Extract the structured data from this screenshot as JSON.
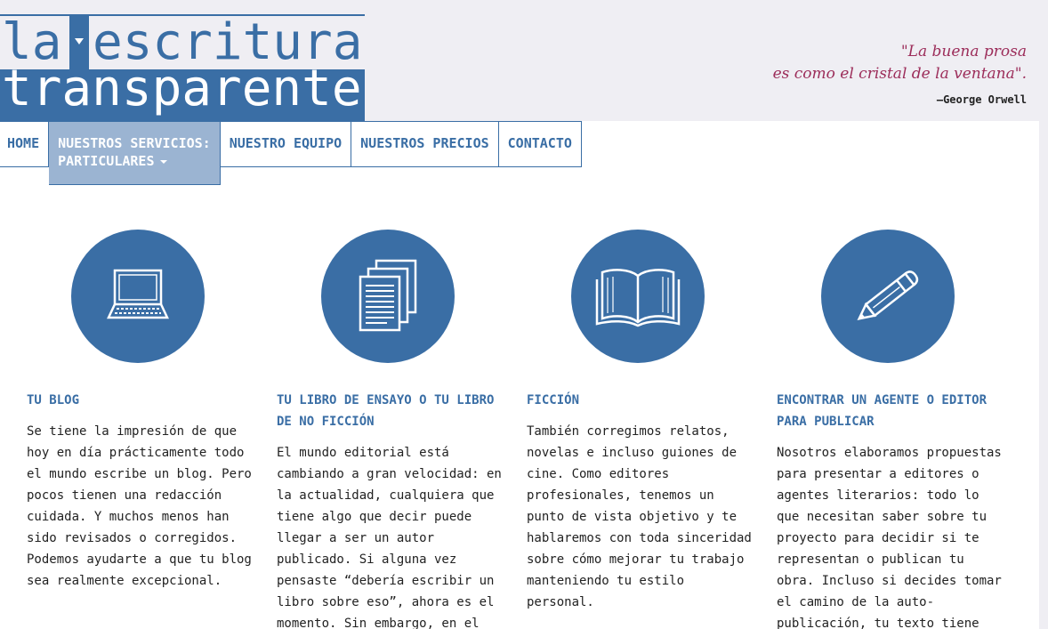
{
  "header": {
    "logo": {
      "word1": "la",
      "word2": "escritura",
      "word3": "transparente"
    },
    "quote": {
      "line1": "\"La buena prosa",
      "line2": "es como el cristal de la ventana\".",
      "author": "–George Orwell"
    }
  },
  "nav": {
    "items": [
      {
        "label": "HOME"
      },
      {
        "label_line1": "NUESTROS SERVICIOS:",
        "label_line2": "PARTICULARES"
      },
      {
        "label": "NUESTRO EQUIPO"
      },
      {
        "label": "NUESTROS PRECIOS"
      },
      {
        "label": "CONTACTO"
      }
    ]
  },
  "services": [
    {
      "icon": "computer-icon",
      "title": "TU BLOG",
      "text": "Se tiene la impresión de que hoy en día prácticamente todo el mundo escribe un blog. Pero pocos tienen una redacción cuidada. Y muchos menos han sido revisados o corregidos. Podemos ayudarte a que tu blog sea realmente excepcional."
    },
    {
      "icon": "documents-icon",
      "title": "TU LIBRO DE ENSAYO O TU LIBRO DE NO FICCIÓN",
      "text": "El mundo editorial está cambiando a gran velocidad: en la actualidad, cualquiera que tiene algo que decir puede llegar a ser un autor publicado. Si alguna vez pensaste “debería escribir un libro sobre eso”, ahora es el momento. Sin embargo, en el"
    },
    {
      "icon": "book-icon",
      "title": "FICCIÓN",
      "text": "También corregimos relatos, novelas e incluso guiones de cine. Como editores profesionales, tenemos un punto de vista objetivo y te hablaremos con toda sinceridad sobre cómo mejorar tu trabajo manteniendo tu estilo personal."
    },
    {
      "icon": "pencil-icon",
      "title": "ENCONTRAR UN AGENTE O EDITOR PARA PUBLICAR",
      "text": "Nosotros elaboramos propuestas para presentar a editores o agentes literarios: todo lo que necesitan saber sobre tu proyecto para decidir si te representan o publican tu obra. Incluso si decides tomar el camino de la auto-publicación, tu texto tiene que ser lo más"
    }
  ],
  "colors": {
    "brand_blue": "#3a6ea5",
    "active_nav": "#9bb4d2",
    "quote": "#9c2d5a"
  }
}
